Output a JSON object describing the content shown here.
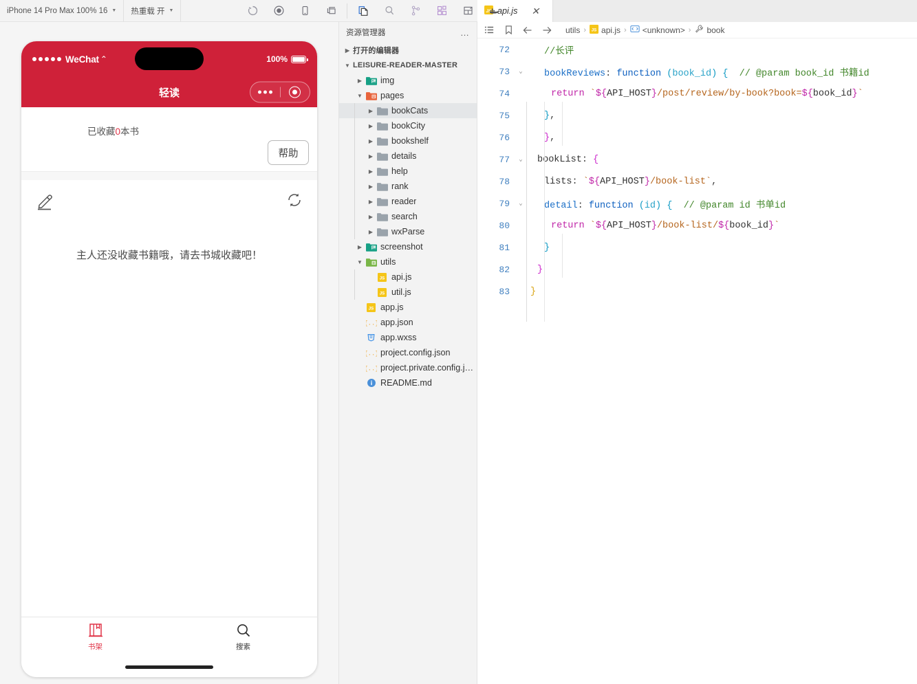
{
  "toolbar": {
    "device_select": "iPhone 14 Pro Max 100% 16",
    "hotreload_select": "热重载 开",
    "icons": [
      {
        "name": "compile-refresh-icon",
        "glyph": "refresh"
      },
      {
        "name": "record-icon",
        "glyph": "record"
      },
      {
        "name": "preview-phone-icon",
        "glyph": "phone"
      },
      {
        "name": "remote-debug-icon",
        "glyph": "windows"
      },
      {
        "name": "clone-icon",
        "glyph": "copy"
      },
      {
        "name": "search-icon",
        "glyph": "magnifier"
      },
      {
        "name": "version-control-icon",
        "glyph": "branch"
      },
      {
        "name": "extensions-icon",
        "glyph": "blocks"
      },
      {
        "name": "layout-icon",
        "glyph": "layout"
      },
      {
        "name": "docker-icon",
        "glyph": "docker"
      }
    ]
  },
  "simulator": {
    "status_bar": {
      "carrier": "WeChat",
      "battery_percent": "100%"
    },
    "navbar": {
      "title": "轻读"
    },
    "shelf": {
      "fav_prefix": "已收藏",
      "fav_count": "0",
      "fav_suffix": "本书",
      "help_label": "帮助",
      "empty_tip": "主人还没收藏书籍哦，请去书城收藏吧！"
    },
    "tabbar": [
      {
        "label": "书架",
        "icon": "bookshelf-icon",
        "active": true
      },
      {
        "label": "搜索",
        "icon": "search-icon",
        "active": false
      }
    ],
    "brand_color": "#cf2139",
    "accent_color": "#e03246"
  },
  "explorer": {
    "title": "资源管理器",
    "more_label": "…",
    "open_editors_label": "打开的编辑器",
    "project_label": "LEISURE-READER-MASTER",
    "tree": [
      {
        "label": "img",
        "type": "folder-img",
        "depth": 1,
        "state": "collapsed",
        "selected": false
      },
      {
        "label": "pages",
        "type": "folder-pages",
        "depth": 1,
        "state": "expanded",
        "selected": false
      },
      {
        "label": "bookCats",
        "type": "folder",
        "depth": 2,
        "state": "collapsed",
        "selected": true
      },
      {
        "label": "bookCity",
        "type": "folder",
        "depth": 2,
        "state": "collapsed",
        "selected": false
      },
      {
        "label": "bookshelf",
        "type": "folder",
        "depth": 2,
        "state": "collapsed",
        "selected": false
      },
      {
        "label": "details",
        "type": "folder",
        "depth": 2,
        "state": "collapsed",
        "selected": false
      },
      {
        "label": "help",
        "type": "folder",
        "depth": 2,
        "state": "collapsed",
        "selected": false
      },
      {
        "label": "rank",
        "type": "folder",
        "depth": 2,
        "state": "collapsed",
        "selected": false
      },
      {
        "label": "reader",
        "type": "folder",
        "depth": 2,
        "state": "collapsed",
        "selected": false
      },
      {
        "label": "search",
        "type": "folder",
        "depth": 2,
        "state": "collapsed",
        "selected": false
      },
      {
        "label": "wxParse",
        "type": "folder",
        "depth": 2,
        "state": "collapsed",
        "selected": false
      },
      {
        "label": "screenshot",
        "type": "folder-img",
        "depth": 1,
        "state": "collapsed",
        "selected": false
      },
      {
        "label": "utils",
        "type": "folder-utils",
        "depth": 1,
        "state": "expanded",
        "selected": false
      },
      {
        "label": "api.js",
        "type": "js",
        "depth": 2,
        "state": "file",
        "selected": false
      },
      {
        "label": "util.js",
        "type": "js",
        "depth": 2,
        "state": "file",
        "selected": false
      },
      {
        "label": "app.js",
        "type": "js",
        "depth": 1,
        "state": "file",
        "selected": false
      },
      {
        "label": "app.json",
        "type": "json",
        "depth": 1,
        "state": "file",
        "selected": false
      },
      {
        "label": "app.wxss",
        "type": "wxss",
        "depth": 1,
        "state": "file",
        "selected": false
      },
      {
        "label": "project.config.json",
        "type": "json",
        "depth": 1,
        "state": "file",
        "selected": false
      },
      {
        "label": "project.private.config.js…",
        "type": "json",
        "depth": 1,
        "state": "file",
        "selected": false
      },
      {
        "label": "README.md",
        "type": "md",
        "depth": 1,
        "state": "file",
        "selected": false
      }
    ]
  },
  "editor": {
    "tab": {
      "label": "api.js",
      "icon": "js-file-icon",
      "close": "✕"
    },
    "breadcrumb": {
      "outline_icon": "outline-icon",
      "bookmark_icon": "bookmark-icon",
      "back_icon": "arrow-left-icon",
      "forward_icon": "arrow-right-icon",
      "items": [
        {
          "label": "utils",
          "icon": ""
        },
        {
          "label": "api.js",
          "icon": "js-file-icon"
        },
        {
          "label": "<unknown>",
          "icon": "module-icon"
        },
        {
          "label": "book",
          "icon": "wrench-icon"
        }
      ],
      "separator": "›"
    },
    "lines": [
      {
        "num": "72",
        "fold": "",
        "indent": 0,
        "tokens": [
          {
            "t": "//长评",
            "c": "t-comment"
          }
        ]
      },
      {
        "num": "73",
        "fold": "⌄",
        "indent": 0,
        "tokens": [
          {
            "t": "bookReviews",
            "c": "t-prop"
          },
          {
            "t": ": ",
            "c": "t-punc"
          },
          {
            "t": "function",
            "c": "t-key"
          },
          {
            "t": " (",
            "c": "t-brace1"
          },
          {
            "t": "book_id",
            "c": "t-param"
          },
          {
            "t": ")",
            "c": "t-brace1"
          },
          {
            "t": " ",
            "c": "t-punc"
          },
          {
            "t": "{",
            "c": "t-brace1"
          },
          {
            "t": "  ",
            "c": "t-punc"
          },
          {
            "t": "// @param book_id 书籍id",
            "c": "t-comment"
          }
        ]
      },
      {
        "num": "74",
        "fold": "",
        "indent": 1,
        "tokens": [
          {
            "t": "return ",
            "c": "t-tpl"
          },
          {
            "t": "`",
            "c": "t-str"
          },
          {
            "t": "${",
            "c": "t-tpl"
          },
          {
            "t": "API_HOST",
            "c": "t-plain"
          },
          {
            "t": "}",
            "c": "t-tpl"
          },
          {
            "t": "/post/review/by-book?book=",
            "c": "t-str"
          },
          {
            "t": "${",
            "c": "t-tpl"
          },
          {
            "t": "book_id",
            "c": "t-plain"
          },
          {
            "t": "}",
            "c": "t-tpl"
          },
          {
            "t": "`",
            "c": "t-str"
          }
        ]
      },
      {
        "num": "75",
        "fold": "",
        "indent": 0,
        "tokens": [
          {
            "t": "}",
            "c": "t-brace1"
          },
          {
            "t": ",",
            "c": "t-punc"
          }
        ]
      },
      {
        "num": "76",
        "fold": "",
        "indent": 0,
        "tokens": [
          {
            "t": "}",
            "c": "t-brace2"
          },
          {
            "t": ",",
            "c": "t-punc"
          }
        ]
      },
      {
        "num": "77",
        "fold": "⌄",
        "indent": -1,
        "tokens": [
          {
            "t": "bookList",
            "c": "t-plain"
          },
          {
            "t": ": ",
            "c": "t-punc"
          },
          {
            "t": "{",
            "c": "t-brace2"
          }
        ]
      },
      {
        "num": "78",
        "fold": "",
        "indent": 0,
        "tokens": [
          {
            "t": "lists",
            "c": "t-plain"
          },
          {
            "t": ": ",
            "c": "t-punc"
          },
          {
            "t": "`",
            "c": "t-str"
          },
          {
            "t": "${",
            "c": "t-tpl"
          },
          {
            "t": "API_HOST",
            "c": "t-plain"
          },
          {
            "t": "}",
            "c": "t-tpl"
          },
          {
            "t": "/book-list",
            "c": "t-str"
          },
          {
            "t": "`",
            "c": "t-str"
          },
          {
            "t": ",",
            "c": "t-punc"
          }
        ]
      },
      {
        "num": "79",
        "fold": "⌄",
        "indent": 0,
        "tokens": [
          {
            "t": "detail",
            "c": "t-prop"
          },
          {
            "t": ": ",
            "c": "t-punc"
          },
          {
            "t": "function",
            "c": "t-key"
          },
          {
            "t": " (",
            "c": "t-brace1"
          },
          {
            "t": "id",
            "c": "t-param"
          },
          {
            "t": ")",
            "c": "t-brace1"
          },
          {
            "t": " ",
            "c": "t-punc"
          },
          {
            "t": "{",
            "c": "t-brace1"
          },
          {
            "t": "  ",
            "c": "t-punc"
          },
          {
            "t": "// @param id 书单id",
            "c": "t-comment"
          }
        ]
      },
      {
        "num": "80",
        "fold": "",
        "indent": 1,
        "tokens": [
          {
            "t": "return ",
            "c": "t-tpl"
          },
          {
            "t": "`",
            "c": "t-str"
          },
          {
            "t": "${",
            "c": "t-tpl"
          },
          {
            "t": "API_HOST",
            "c": "t-plain"
          },
          {
            "t": "}",
            "c": "t-tpl"
          },
          {
            "t": "/book-list/",
            "c": "t-str"
          },
          {
            "t": "${",
            "c": "t-tpl"
          },
          {
            "t": "book_id",
            "c": "t-plain"
          },
          {
            "t": "}",
            "c": "t-tpl"
          },
          {
            "t": "`",
            "c": "t-str"
          }
        ]
      },
      {
        "num": "81",
        "fold": "",
        "indent": 0,
        "tokens": [
          {
            "t": "}",
            "c": "t-brace1"
          }
        ]
      },
      {
        "num": "82",
        "fold": "",
        "indent": -1,
        "tokens": [
          {
            "t": "}",
            "c": "t-brace2"
          }
        ]
      },
      {
        "num": "83",
        "fold": "",
        "indent": -2,
        "tokens": [
          {
            "t": "}",
            "c": "t-brace3"
          }
        ]
      }
    ]
  }
}
